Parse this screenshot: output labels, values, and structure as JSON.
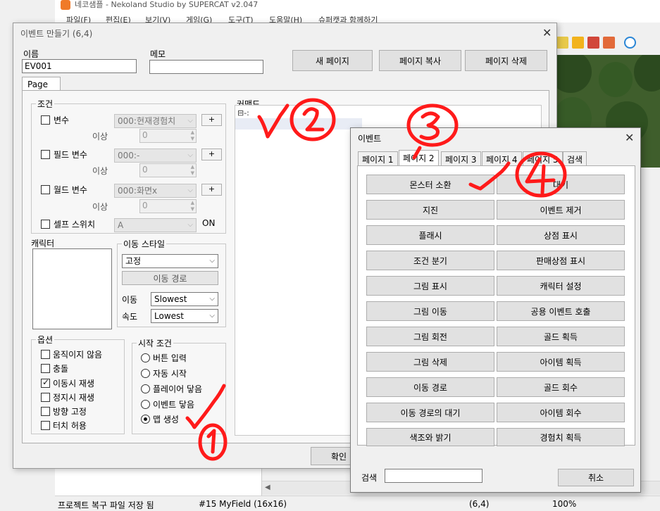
{
  "app": {
    "title": "네코샘플 - Nekoland Studio by SUPERCAT v2.047",
    "menu": [
      "파일(F)",
      "편집(E)",
      "보기(V)",
      "게임(G)",
      "도구(T)",
      "도움말(H)",
      "슈퍼캣과 함께하기"
    ],
    "status": {
      "message": "프로젝트 복구 파일 저장 됨",
      "map": "#15 MyField (16x16)",
      "coords": "(6,4)",
      "zoom": "100%"
    }
  },
  "event_dialog": {
    "title": "이벤트 만들기 (6,4)",
    "name_label": "이름",
    "name_value": "EV001",
    "memo_label": "메모",
    "memo_value": "",
    "new_page": "새 페이지",
    "copy_page": "페이지 복사",
    "delete_page": "페이지 삭제",
    "page_tab": "Page 1",
    "conditions": {
      "title": "조건",
      "variable_label": "변수",
      "variable_value": "000:현재경험치",
      "variable_compare": "이상",
      "variable_number": "0",
      "field_variable_label": "필드 변수",
      "field_variable_value": "000:-",
      "field_compare": "이상",
      "field_number": "0",
      "world_variable_label": "월드 변수",
      "world_variable_value": "000:화면x",
      "world_compare": "이상",
      "world_number": "0",
      "self_switch_label": "셀프 스위치",
      "self_switch_value": "A",
      "self_switch_state": "ON",
      "plus": "+"
    },
    "character_label": "캐릭터",
    "movement": {
      "title": "이동 스타일",
      "type": "고정",
      "route_button": "이동 경로",
      "speed_label": "이동",
      "speed_value": "Slowest",
      "freq_label": "속도",
      "freq_value": "Lowest"
    },
    "options": {
      "title": "옵션",
      "items": [
        {
          "label": "움직이지 않음",
          "checked": false
        },
        {
          "label": "충돌",
          "checked": false
        },
        {
          "label": "이동시 재생",
          "checked": true
        },
        {
          "label": "정지시 재생",
          "checked": false
        },
        {
          "label": "방향 고정",
          "checked": false
        },
        {
          "label": "터치 허용",
          "checked": false
        }
      ]
    },
    "trigger": {
      "title": "시작 조건",
      "items": [
        {
          "label": "버튼 입력",
          "selected": false
        },
        {
          "label": "자동 시작",
          "selected": false
        },
        {
          "label": "플레이어 닿음",
          "selected": false
        },
        {
          "label": "이벤트 닿음",
          "selected": false
        },
        {
          "label": "맵 생성",
          "selected": true
        }
      ]
    },
    "commands_label": "커맨드",
    "tree_root": "⊟-:",
    "ok_button": "확인"
  },
  "command_dialog": {
    "title": "이벤트",
    "tabs": [
      "페이지 1",
      "페이지 2",
      "페이지 3",
      "페이지 4",
      "페이지 5",
      "검색"
    ],
    "active_tab": 1,
    "buttons": [
      [
        "몬스터 소환",
        "대기"
      ],
      [
        "지진",
        "이벤트 제거"
      ],
      [
        "플래시",
        "상점 표시"
      ],
      [
        "조건 분기",
        "판매상점 표시"
      ],
      [
        "그림 표시",
        "캐릭터 설정"
      ],
      [
        "그림 이동",
        "공용 이벤트 호출"
      ],
      [
        "그림 회전",
        "골드 획득"
      ],
      [
        "그림 삭제",
        "아이템 획득"
      ],
      [
        "이동 경로",
        "골드 회수"
      ],
      [
        "이동 경로의 대기",
        "아이템 회수"
      ],
      [
        "색조와 밝기",
        "경험치 획득"
      ]
    ],
    "search_label": "검색",
    "search_value": "",
    "cancel_button": "취소"
  },
  "annotation_color": "#ff1a1a"
}
